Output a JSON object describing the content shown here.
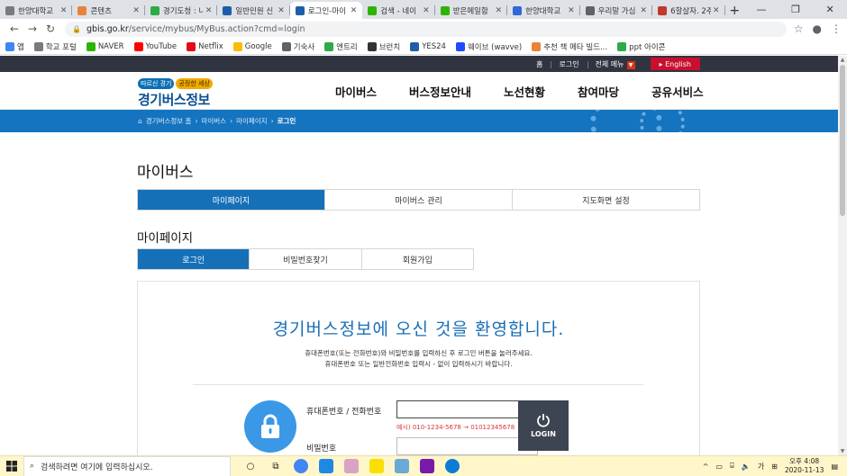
{
  "browser": {
    "tabs": [
      {
        "title": "한양대학교",
        "color": "#7a7a7a",
        "active": false
      },
      {
        "title": "콘텐츠",
        "color": "#e8833a",
        "active": false
      },
      {
        "title": "경기도청 : 나",
        "color": "#2eaa4a",
        "active": false
      },
      {
        "title": "일반민원 신",
        "color": "#1e5ea8",
        "active": false
      },
      {
        "title": "로그인-마이",
        "color": "#1e5ea8",
        "active": true
      },
      {
        "title": "검색 - 네이",
        "color": "#2db400",
        "active": false
      },
      {
        "title": "받은메일함",
        "color": "#2db400",
        "active": false
      },
      {
        "title": "한양대학교",
        "color": "#3367d6",
        "active": false
      },
      {
        "title": "우리말 가심",
        "color": "#5f6368",
        "active": false
      },
      {
        "title": "6할살자. 2주",
        "color": "#c0392b",
        "active": false
      }
    ],
    "url_host": "gbis.go.kr",
    "url_path": "/service/mybus/MyBus.action?cmd=login",
    "bookmarks": [
      {
        "label": "앱",
        "color": "#4285f4"
      },
      {
        "label": "학교 포털",
        "color": "#7a7a7a"
      },
      {
        "label": "NAVER",
        "color": "#2db400"
      },
      {
        "label": "YouTube",
        "color": "#ff0000"
      },
      {
        "label": "Netflix",
        "color": "#e50914"
      },
      {
        "label": "Google",
        "color": "#fbbc05"
      },
      {
        "label": "기숙사",
        "color": "#5f6368"
      },
      {
        "label": "엔트리",
        "color": "#2eaa4a"
      },
      {
        "label": "브런치",
        "color": "#333333"
      },
      {
        "label": "YES24",
        "color": "#1e5ea8"
      },
      {
        "label": "웨이브 (wavve)",
        "color": "#1f4bff"
      },
      {
        "label": "추천 책 메타 빌드...",
        "color": "#e8833a"
      },
      {
        "label": "ppt 아이콘",
        "color": "#2eaa4a"
      }
    ]
  },
  "site": {
    "util": {
      "home": "홈",
      "login": "로그인",
      "all_menu": "전체 메뉴",
      "english": "English"
    },
    "logo": {
      "slogan1": "따르신 경기",
      "slogan2": "공정한 세상",
      "name": "경기버스정보"
    },
    "gnb": [
      "마이버스",
      "버스정보안내",
      "노선현황",
      "참여마당",
      "공유서비스"
    ],
    "breadcrumb": [
      "경기버스정보 홈",
      "마이버스",
      "마이페이지",
      "로그인"
    ],
    "title": "마이버스",
    "main_tabs": [
      {
        "label": "마이페이지",
        "on": true
      },
      {
        "label": "마이버스 관리",
        "on": false
      },
      {
        "label": "지도화면 설정",
        "on": false
      }
    ],
    "subtitle": "마이페이지",
    "sub_tabs": [
      {
        "label": "로그인",
        "on": true
      },
      {
        "label": "비밀번호찾기",
        "on": false
      },
      {
        "label": "회원가입",
        "on": false
      }
    ],
    "login": {
      "welcome": "경기버스정보에 오신 것을 환영합니다.",
      "desc1": "휴대폰번호(또는 전화번호)와 비밀번호를 입력하신 후 로그인 버튼을 눌러주세요.",
      "desc2": "휴대폰번호 또는 일반전화번호 입력시 - 없이 입력하시기 바랍니다.",
      "phone_label": "휴대폰번호 / 전화번호",
      "phone_hint": "예시) 010-1234-5678 → 01012345678",
      "pw_label": "비밀번호",
      "button": "LOGIN"
    }
  },
  "taskbar": {
    "search_placeholder": "검색하려면 여기에 입력하십시오.",
    "ime": "가",
    "time": "오후 4:08",
    "date": "2020-11-13"
  }
}
